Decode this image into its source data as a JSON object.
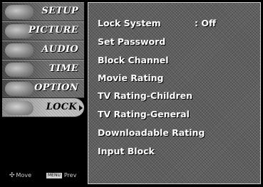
{
  "nav": {
    "items": [
      {
        "label": "SETUP",
        "active": false
      },
      {
        "label": "PICTURE",
        "active": false
      },
      {
        "label": "AUDIO",
        "active": false
      },
      {
        "label": "TIME",
        "active": false
      },
      {
        "label": "OPTION",
        "active": false
      },
      {
        "label": "LOCK",
        "active": true
      }
    ],
    "footer": {
      "move_icon": "✣",
      "move_label": "Move",
      "menu_key": "MENU",
      "prev_label": "Prev"
    }
  },
  "lock_menu": {
    "items": [
      {
        "label": "Lock System",
        "value": ": Off"
      },
      {
        "label": "Set Password"
      },
      {
        "label": "Block Channel"
      },
      {
        "label": "Movie Rating"
      },
      {
        "label": "TV Rating-Children"
      },
      {
        "label": "TV Rating-General"
      },
      {
        "label": "Downloadable Rating"
      },
      {
        "label": "Input Block"
      }
    ]
  }
}
